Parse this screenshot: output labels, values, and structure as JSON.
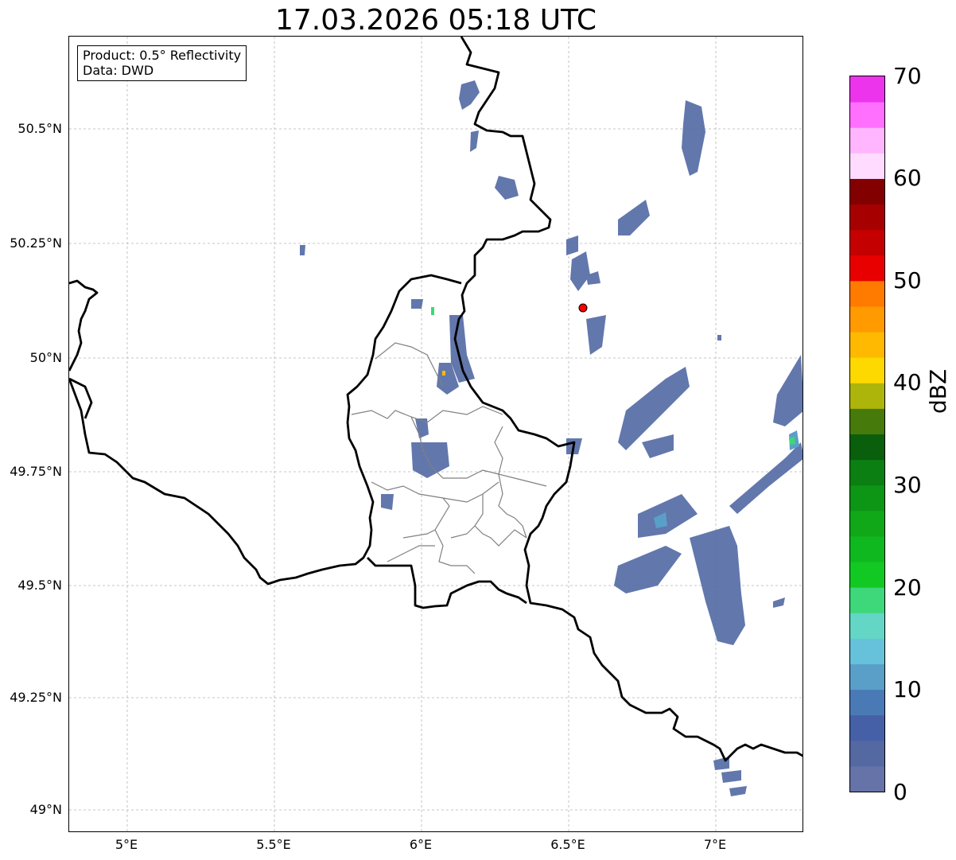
{
  "title": "17.03.2026 05:18 UTC",
  "info": {
    "product": "Product: 0.5° Reflectivity",
    "data": "Data: DWD"
  },
  "lat_ticks": [
    "50.5°N",
    "50.25°N",
    "50°N",
    "49.75°N",
    "49.5°N",
    "49.25°N",
    "49°N"
  ],
  "lon_ticks": [
    "5°E",
    "5.5°E",
    "6°E",
    "6.5°E",
    "7°E"
  ],
  "colorbar": {
    "label": "dBZ",
    "ticks": [
      "0",
      "10",
      "20",
      "30",
      "40",
      "50",
      "60",
      "70"
    ],
    "levels": [
      0,
      2.5,
      5,
      7.5,
      10,
      12.5,
      15,
      17.5,
      20,
      22.5,
      25,
      27.5,
      30,
      32.5,
      35,
      37.5,
      40,
      42.5,
      45,
      47.5,
      50,
      52.5,
      55,
      57.5,
      60,
      62.5,
      65,
      67.5,
      70
    ],
    "colors": [
      "#6673a8",
      "#5468a2",
      "#4560a6",
      "#4a7ab5",
      "#5a9fc8",
      "#66c2da",
      "#63d6c6",
      "#3ed77a",
      "#12c822",
      "#10b820",
      "#10a818",
      "#0d9515",
      "#0b7f12",
      "#095f0b",
      "#467a0b",
      "#adb50a",
      "#fdd900",
      "#ffb900",
      "#ff9a00",
      "#ff7b00",
      "#e80000",
      "#c50000",
      "#a60000",
      "#820000",
      "#ffdcff",
      "#ffb6ff",
      "#ff70ff",
      "#ec34ec"
    ]
  },
  "radar_site_color": "#ff0000",
  "border_color": "#000000",
  "district_color": "#808080"
}
